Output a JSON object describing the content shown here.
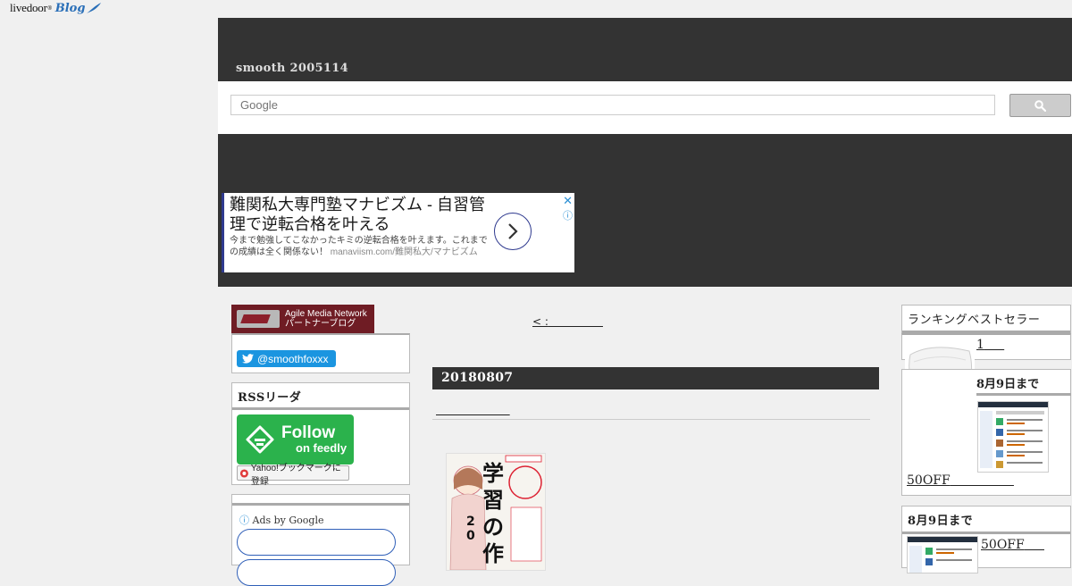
{
  "logo": {
    "brand": "livedoor",
    "sub": "Blog"
  },
  "header": {
    "site_title": "smooth 2005114",
    "search_placeholder": "Google"
  },
  "ad_banner": {
    "headline": "難関私大専門塾マナビズム - 自習管理で逆転合格を叶える",
    "body": "今まで勉強してこなかったキミの逆転合格を叶えます。これまでの成績は全く関係ない！",
    "url": "manaviism.com/難関私大/マナビズム"
  },
  "left_sidebar": {
    "amn_badge": {
      "line1": "Agile Media Network",
      "line2": "パートナーブログ"
    },
    "twitter_handle": "@smoothfoxxx",
    "rss_title": "RSSリーダ",
    "feedly": {
      "line1": "Follow",
      "line2": "on feedly"
    },
    "yahoo_bookmark": "Yahoo!ブックマークに登録",
    "ads_by_google": "Ads by Google"
  },
  "main": {
    "prev_link": "< :",
    "date": "20180807",
    "entry_title": ""
  },
  "right_sidebar": {
    "ranking_title": "ランキングベストセラー",
    "rank1_label": "1",
    "sale1_title": "8月9日まで",
    "sale1_link": "50OFF",
    "sale2_title": "8月9日まで",
    "sale2_link": "50OFF"
  },
  "colors": {
    "header_bg": "#333333",
    "twitter": "#1b95e0",
    "feedly": "#2bb24c",
    "amn": "#6f1c24",
    "ad_accent": "#2f3a8f"
  }
}
